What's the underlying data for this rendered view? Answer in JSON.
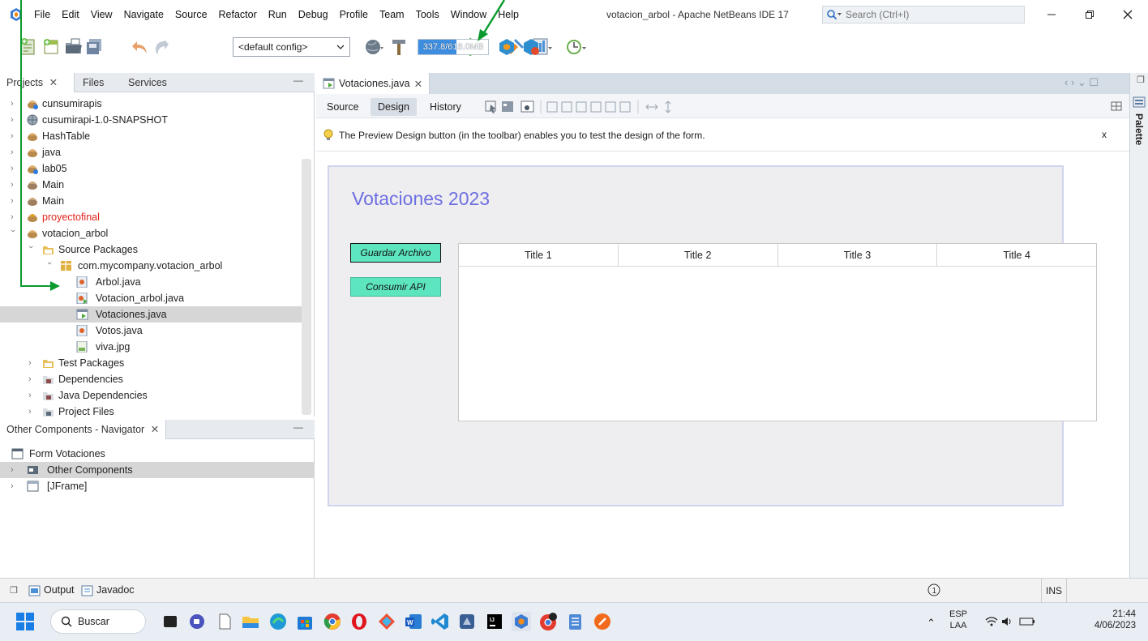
{
  "menubar": {
    "items": [
      "File",
      "Edit",
      "View",
      "Navigate",
      "Source",
      "Refactor",
      "Run",
      "Debug",
      "Profile",
      "Team",
      "Tools",
      "Window",
      "Help"
    ],
    "window_title": "votacion_arbol - Apache NetBeans IDE 17",
    "search_placeholder": "Search (Ctrl+I)"
  },
  "toolbar": {
    "config": "<default config>",
    "memory": "337.8/618.0MB",
    "memory_used_fraction": 0.55
  },
  "projects_panel": {
    "tabs": [
      "Projects",
      "Files",
      "Services"
    ],
    "tree": [
      {
        "label": "cunsumirapis",
        "icon": "maven-project-icon"
      },
      {
        "label": "cusumirapi-1.0-SNAPSHOT",
        "icon": "globe-icon"
      },
      {
        "label": "HashTable",
        "icon": "java-project-icon"
      },
      {
        "label": "java",
        "icon": "java-project-icon"
      },
      {
        "label": "lab05",
        "icon": "maven-project-icon"
      },
      {
        "label": "Main",
        "icon": "java-project-icon"
      },
      {
        "label": "Main",
        "icon": "java-project-icon"
      },
      {
        "label": "proyectofinal",
        "icon": "java-project-icon"
      },
      {
        "label": "votacion_arbol",
        "icon": "java-project-icon"
      },
      {
        "label": "Source Packages",
        "icon": "package-folder-icon"
      },
      {
        "label": "com.mycompany.votacion_arbol",
        "icon": "package-icon"
      },
      {
        "label": "Arbol.java",
        "icon": "java-file-icon"
      },
      {
        "label": "Votacion_arbol.java",
        "icon": "java-main-file-icon"
      },
      {
        "label": "Votaciones.java",
        "icon": "form-file-icon"
      },
      {
        "label": "Votos.java",
        "icon": "java-file-icon"
      },
      {
        "label": "viva.jpg",
        "icon": "image-file-icon"
      },
      {
        "label": "Test Packages",
        "icon": "package-folder-icon"
      },
      {
        "label": "Dependencies",
        "icon": "library-folder-icon"
      },
      {
        "label": "Java Dependencies",
        "icon": "library-folder-icon"
      },
      {
        "label": "Project Files",
        "icon": "project-files-icon"
      }
    ]
  },
  "navigator_panel": {
    "tab": "Other Components - Navigator",
    "items": [
      "Form Votaciones",
      "Other Components",
      "[JFrame]"
    ]
  },
  "editor": {
    "tab": "Votaciones.java",
    "views": [
      "Source",
      "Design",
      "History"
    ],
    "active_view": "Design",
    "hint": "The Preview Design button (in the toolbar) enables you to test the design of the form.",
    "hint_close": "x",
    "palette_label": "Palette"
  },
  "form": {
    "title": "Votaciones 2023",
    "buttons": [
      "Guardar Archivo",
      "Consumir API"
    ],
    "table_columns": [
      "Title 1",
      "Title 2",
      "Title 3",
      "Title 4"
    ],
    "title_color": "#6e6fe0",
    "button_color": "#5de5c0"
  },
  "statusbar": {
    "tabs": [
      "Output",
      "Javadoc"
    ],
    "mode": "INS"
  },
  "taskbar": {
    "search": "Buscar",
    "lang1": "ESP",
    "lang2": "LAA",
    "time": "21:44",
    "date": "4/06/2023"
  },
  "accent_colors": {
    "annotation_arrow": "#0a9a2e",
    "selection": "#d6d6d6",
    "error_project": "#e2231a"
  }
}
